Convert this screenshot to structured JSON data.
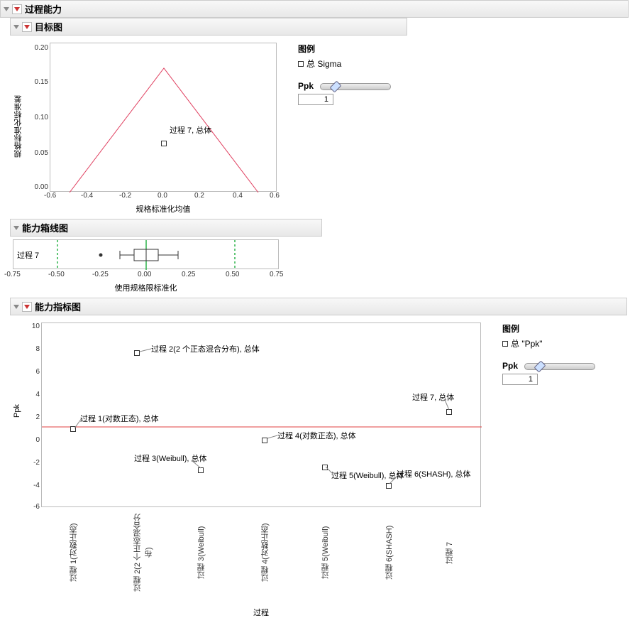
{
  "main_header": "过程能力",
  "goal": {
    "header": "目标图",
    "ylabel": "规格标准化标准差",
    "xlabel": "规格标准化均值",
    "xticks": [
      "-0.6",
      "-0.4",
      "-0.2",
      "0.0",
      "0.2",
      "0.4",
      "0.6"
    ],
    "yticks": [
      "0.00",
      "0.05",
      "0.10",
      "0.15",
      "0.20"
    ],
    "point_label": "过程 7, 总体",
    "legend": {
      "title": "图例",
      "item": "总 Sigma"
    },
    "ppk_label": "Ppk",
    "ppk_value": "1"
  },
  "box": {
    "header": "能力箱线图",
    "xlabel": "使用规格限标准化",
    "row_label": "过程 7",
    "xticks": [
      "-0.75",
      "-0.50",
      "-0.25",
      "0.00",
      "0.25",
      "0.50",
      "0.75"
    ]
  },
  "capi": {
    "header": "能力指标图",
    "ylabel": "Ppk",
    "xlabel": "过程",
    "yticks": [
      "-6",
      "-4",
      "-2",
      "0",
      "2",
      "4",
      "6",
      "8",
      "10"
    ],
    "categories": [
      "过程 1(对数正态)",
      "过程 2(2 个正态混合分布)",
      "过程 3(Weibull)",
      "过程 4(对数正态)",
      "过程 5(Weibull)",
      "过程 6(SHASH)",
      "过程 7"
    ],
    "point_labels": {
      "p1": "过程 1(对数正态), 总体",
      "p2": "过程 2(2 个正态混合分布), 总体",
      "p3": "过程 3(Weibull), 总体",
      "p4": "过程 4(对数正态), 总体",
      "p5": "过程 5(Weibull), 总体",
      "p6": "过程 6(SHASH), 总体",
      "p7": "过程 7, 总体"
    },
    "legend": {
      "title": "图例",
      "item": "总 \"Ppk\""
    },
    "ppk_label": "Ppk",
    "ppk_value": "1"
  },
  "chart_data": [
    {
      "type": "scatter",
      "name": "goal_plot",
      "xlabel": "规格标准化均值",
      "ylabel": "规格标准化标准差",
      "xlim": [
        -0.6,
        0.6
      ],
      "ylim": [
        0.0,
        0.2
      ],
      "series": [
        {
          "name": "总 Sigma",
          "points": [
            {
              "x": 0.0,
              "y": 0.068,
              "label": "过程 7, 总体"
            }
          ]
        }
      ],
      "triangle_vertices": [
        {
          "x": -0.5,
          "y": 0.0
        },
        {
          "x": 0.0,
          "y": 0.167
        },
        {
          "x": 0.5,
          "y": 0.0
        }
      ]
    },
    {
      "type": "box",
      "name": "capability_box",
      "xlabel": "使用规格限标准化",
      "xlim": [
        -0.75,
        0.75
      ],
      "spec_limits": [
        -0.5,
        0.5
      ],
      "center_line": 0.0,
      "rows": [
        {
          "label": "过程 7",
          "q1": -0.07,
          "median": 0.0,
          "q3": 0.07,
          "whisker_low": -0.15,
          "whisker_high": 0.18,
          "outliers": [
            -0.26
          ]
        }
      ]
    },
    {
      "type": "scatter",
      "name": "capability_index",
      "xlabel": "过程",
      "ylabel": "Ppk",
      "ylim": [
        -6,
        10
      ],
      "reference_line": 1,
      "categories": [
        "过程 1(对数正态)",
        "过程 2(2 个正态混合分布)",
        "过程 3(Weibull)",
        "过程 4(对数正态)",
        "过程 5(Weibull)",
        "过程 6(SHASH)",
        "过程 7"
      ],
      "series": [
        {
          "name": "总 \"Ppk\"",
          "values": [
            1.0,
            7.7,
            -2.6,
            0.0,
            -2.3,
            -4.0,
            2.5
          ]
        }
      ]
    }
  ]
}
